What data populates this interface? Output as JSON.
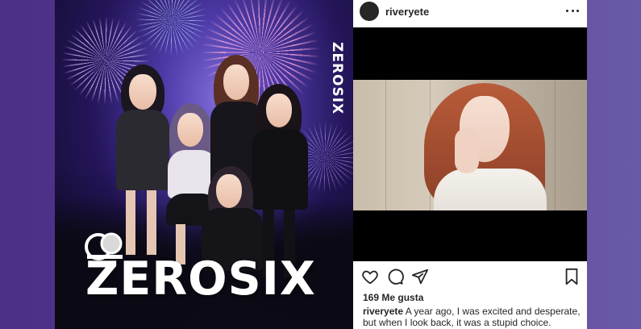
{
  "poster": {
    "vertical_title": "ZEROSIX",
    "title": "ZEROSIX"
  },
  "post": {
    "username": "riveryete",
    "likes": "169 Me gusta",
    "caption_user": "riveryete",
    "caption_text": "A year ago, I was excited and desperate, but when I look back, it was a stupid choice."
  },
  "icons": {
    "more": "more-options-icon",
    "like": "heart-icon",
    "comment": "comment-icon",
    "share": "share-icon",
    "save": "bookmark-icon"
  }
}
